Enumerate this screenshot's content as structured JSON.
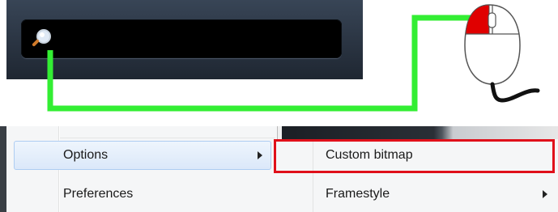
{
  "search": {
    "value": "",
    "icon": "magnifier-icon"
  },
  "menu": {
    "items": [
      {
        "label": "Options",
        "has_submenu": true,
        "hovered": true
      },
      {
        "label": "Preferences",
        "has_submenu": false,
        "hovered": false
      }
    ]
  },
  "submenu": {
    "items": [
      {
        "label": "Custom bitmap",
        "has_submenu": false,
        "highlighted": true
      },
      {
        "label": "Framestyle",
        "has_submenu": true,
        "highlighted": false
      }
    ]
  },
  "colors": {
    "connector": "#33ee33",
    "highlight": "#e0101a",
    "mouse_button": "#e00000"
  }
}
